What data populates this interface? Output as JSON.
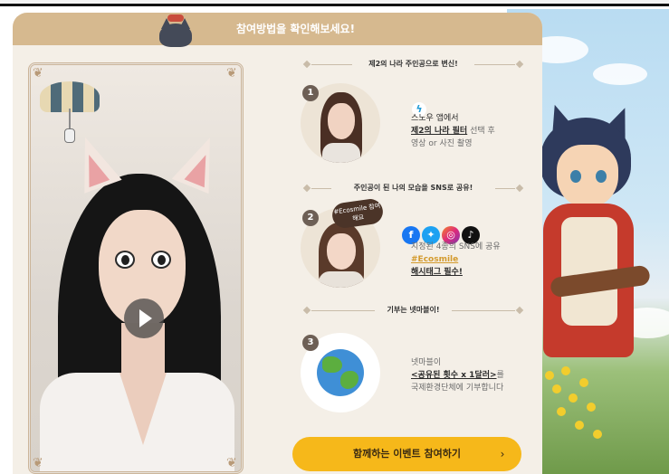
{
  "header": {
    "title": "참여방법을 확인해보세요!"
  },
  "colors": {
    "header_bg": "#d6b98f",
    "panel_bg": "#f4efe7",
    "cta_bg": "#f6b81a",
    "accent": "#d39a2c"
  },
  "sections": [
    {
      "divider": "제2의 나라 주인공으로 변신!"
    },
    {
      "divider": "주인공이 된 나의 모습을 SNS로 공유!"
    },
    {
      "divider": "기부는 넷마블이!"
    }
  ],
  "steps": [
    {
      "number": "1",
      "icon": "bolt-icon",
      "line1": "스노우 앱에서",
      "line2_bold": "제2의 나라 필터",
      "line2_rest": " 선택 후",
      "line3": "영상 or 사진 촬영"
    },
    {
      "number": "2",
      "sticker": "#Ecosmile 참여해요",
      "sns": [
        "facebook-icon",
        "twitter-icon",
        "instagram-icon",
        "tiktok-icon"
      ],
      "line1": "지정된 4종의 SNS에 공유",
      "line2_accent": "#Ecosmile",
      "line3_bold": "해시태그 필수!"
    },
    {
      "number": "3",
      "icon": "earth-icon",
      "line1": "넷마블이",
      "line2_bold": "<공유된 횟수 x 1달러>",
      "line2_rest": "를",
      "line3": "국제환경단체에 기부합니다"
    }
  ],
  "video": {
    "play_icon": "play-icon"
  },
  "cta": {
    "label": "함께하는 이벤트 참여하기",
    "arrow": "›"
  }
}
